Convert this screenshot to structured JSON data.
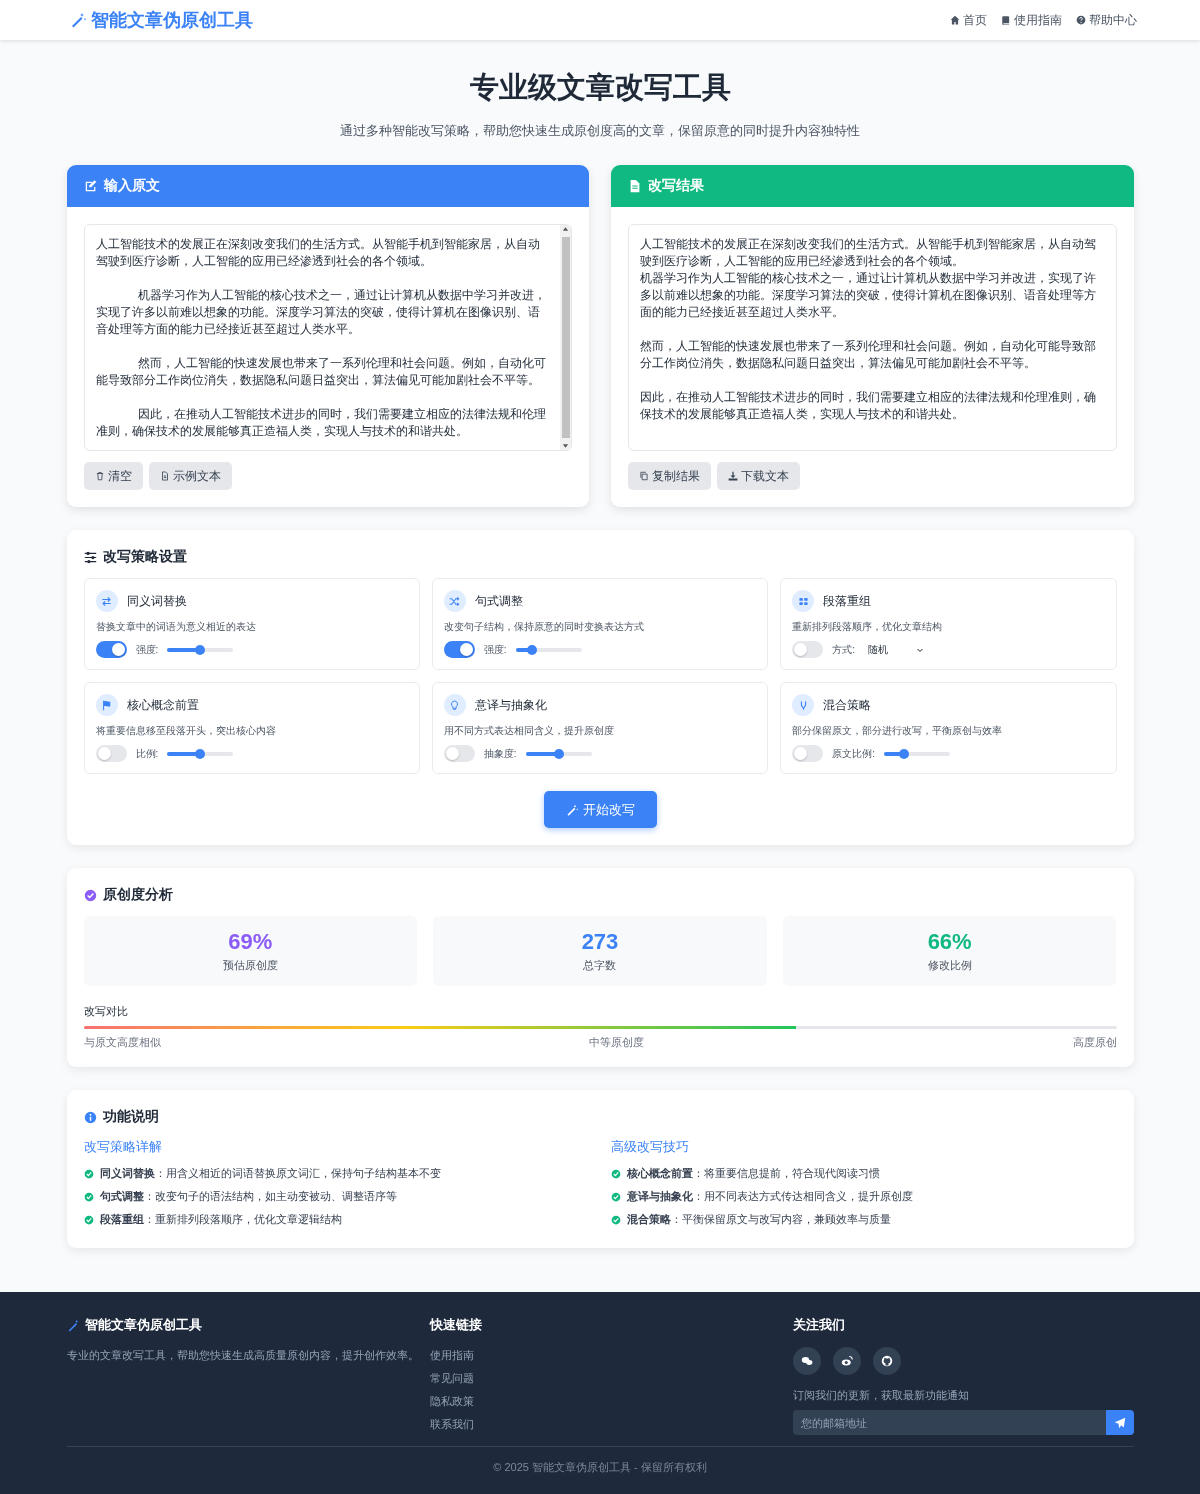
{
  "nav": {
    "brand": "智能文章伪原创工具",
    "links": [
      {
        "kind": "home",
        "label": "首页"
      },
      {
        "kind": "book",
        "label": "使用指南"
      },
      {
        "kind": "help",
        "label": "帮助中心"
      }
    ]
  },
  "hero": {
    "title": "专业级文章改写工具",
    "subtitle": "通过多种智能改写策略，帮助您快速生成原创度高的文章，保留原意的同时提升内容独特性"
  },
  "input_panel": {
    "title": "输入原文",
    "paragraphs": [
      {
        "text": "人工智能技术的发展正在深刻改变我们的生活方式。从智能手机到智能家居，从自动驾驶到医疗诊断，人工智能的应用已经渗透到社会的各个领域。",
        "indent": false
      },
      {
        "text": "机器学习作为人工智能的核心技术之一，通过让计算机从数据中学习并改进，实现了许多以前难以想象的功能。深度学习算法的突破，使得计算机在图像识别、语音处理等方面的能力已经接近甚至超过人类水平。",
        "indent": true
      },
      {
        "text": "然而，人工智能的快速发展也带来了一系列伦理和社会问题。例如，自动化可能导致部分工作岗位消失，数据隐私问题日益突出，算法偏见可能加剧社会不平等。",
        "indent": true
      },
      {
        "text": "因此，在推动人工智能技术进步的同时，我们需要建立相应的法律法规和伦理准则，确保技术的发展能够真正造福人类，实现人与技术的和谐共处。",
        "indent": true
      }
    ],
    "buttons": [
      {
        "kind": "trash",
        "label": "清空"
      },
      {
        "kind": "file",
        "label": "示例文本"
      }
    ]
  },
  "result_panel": {
    "title": "改写结果",
    "blocks": [
      {
        "paragraphs": [
          "人工智能技术的发展正在深刻改变我们的生活方式。从智能手机到智能家居，从自动驾驶到医疗诊断，人工智能的应用已经渗透到社会的各个领域。",
          "机器学习作为人工智能的核心技术之一，通过让计算机从数据中学习并改进，实现了许多以前难以想象的功能。深度学习算法的突破，使得计算机在图像识别、语音处理等方面的能力已经接近甚至超过人类水平。"
        ]
      },
      {
        "paragraphs": [
          "然而，人工智能的快速发展也带来了一系列伦理和社会问题。例如，自动化可能导致部分工作岗位消失，数据隐私问题日益突出，算法偏见可能加剧社会不平等。"
        ]
      },
      {
        "paragraphs": [
          "因此，在推动人工智能技术进步的同时，我们需要建立相应的法律法规和伦理准则，确保技术的发展能够真正造福人类，实现人与技术的和谐共处。"
        ]
      }
    ],
    "buttons": [
      {
        "kind": "copy",
        "label": "复制结果"
      },
      {
        "kind": "download",
        "label": "下载文本"
      }
    ]
  },
  "strategies": {
    "title": "改写策略设置",
    "items": [
      {
        "title": "同义词替换",
        "description": "替换文章中的词语为意义相近的表达",
        "on": true,
        "kind": "slider",
        "control_label": "强度:",
        "level": 0.5
      },
      {
        "title": "句式调整",
        "description": "改变句子结构，保持原意的同时变换表达方式",
        "on": true,
        "kind": "slider",
        "control_label": "强度:",
        "level": 0.25
      },
      {
        "title": "段落重组",
        "description": "重新排列段落顺序，优化文章结构",
        "on": false,
        "kind": "select",
        "control_label": "方式:",
        "value": "随机"
      },
      {
        "title": "核心概念前置",
        "description": "将重要信息移至段落开头，突出核心内容",
        "on": false,
        "kind": "slider",
        "control_label": "比例:",
        "level": 0.5
      },
      {
        "title": "意译与抽象化",
        "description": "用不同方式表达相同含义，提升原创度",
        "on": false,
        "kind": "slider",
        "control_label": "抽象度:",
        "level": 0.5
      },
      {
        "title": "混合策略",
        "description": "部分保留原文，部分进行改写，平衡原创与效率",
        "on": false,
        "kind": "slider",
        "control_label": "原文比例:",
        "level": 0.3
      }
    ],
    "button": "开始改写"
  },
  "analysis": {
    "title": "原创度分析",
    "stats": [
      {
        "value": "69%",
        "label": "预估原创度",
        "color": "#8b5cf6"
      },
      {
        "value": "273",
        "label": "总字数",
        "color": "#3b82f6"
      },
      {
        "value": "66%",
        "label": "修改比例",
        "color": "#10b981"
      }
    ],
    "comparison": {
      "label": "改写对比",
      "level": 0.69,
      "scale": [
        "与原文高度相似",
        "中等原创度",
        "高度原创"
      ]
    }
  },
  "features": {
    "title": "功能说明",
    "columns": [
      {
        "heading": "改写策略详解",
        "items": [
          "**同义词替换**：用含义相近的词语替换原文词汇，保持句子结构基本不变",
          "**句式调整**：改变句子的语法结构，如主动变被动、调整语序等",
          "**段落重组**：重新排列段落顺序，优化文章逻辑结构"
        ]
      },
      {
        "heading": "高级改写技巧",
        "items": [
          "**核心概念前置**：将重要信息提前，符合现代阅读习惯",
          "**意译与抽象化**：用不同表达方式传达相同含义，提升原创度",
          "**混合策略**：平衡保留原文与改写内容，兼顾效率与质量"
        ]
      }
    ]
  },
  "footer": {
    "brand": "智能文章伪原创工具",
    "description": "专业的文章改写工具，帮助您快速生成高质量原创内容，提升创作效率。",
    "links_title": "快速链接",
    "links": [
      "使用指南",
      "常见问题",
      "隐私政策",
      "联系我们"
    ],
    "follow_title": "关注我们",
    "social": [
      {
        "kind": "chat"
      },
      {
        "kind": "eye"
      },
      {
        "kind": "cat"
      }
    ],
    "subscribe_text": "订阅我们的更新，获取最新功能通知",
    "email_placeholder": "您的邮箱地址",
    "copyright": "© 2025 智能文章伪原创工具 - 保留所有权利"
  }
}
